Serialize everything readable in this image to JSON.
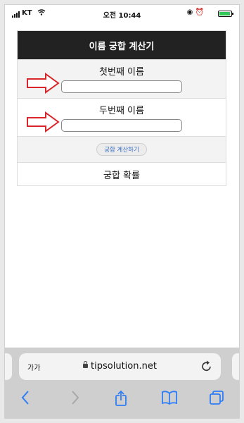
{
  "status_bar": {
    "carrier": "KT",
    "time": "오전 10:44"
  },
  "calculator": {
    "title": "이름 궁합 계산기",
    "first_name_label": "첫번째 이름",
    "first_name_value": "",
    "second_name_label": "두번째 이름",
    "second_name_value": "",
    "calculate_button": "궁합 계산하기",
    "result_label": "궁합 확률"
  },
  "safari": {
    "text_size_label": "가가",
    "url": "tipsolution.net"
  },
  "colors": {
    "header_bg": "#222222",
    "annotation_arrow": "#d9262b",
    "link_blue": "#3a6fc8",
    "toolbar_icon": "#2f7df6"
  }
}
